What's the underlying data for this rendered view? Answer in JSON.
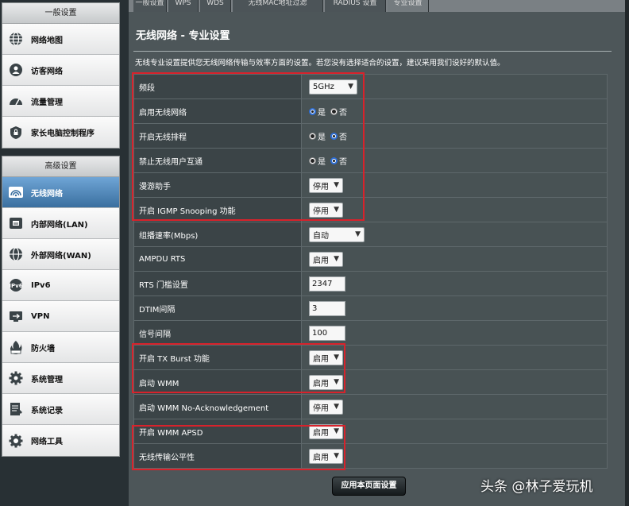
{
  "sidebar": {
    "general_title": "一般设置",
    "general_items": [
      {
        "label": "网络地图",
        "icon": "globe-icon"
      },
      {
        "label": "访客网络",
        "icon": "guest-network-icon"
      },
      {
        "label": "流量管理",
        "icon": "speedometer-icon"
      },
      {
        "label": "家长电脑控制程序",
        "icon": "parental-lock-icon"
      }
    ],
    "advanced_title": "高级设置",
    "advanced_items": [
      {
        "label": "无线网络",
        "icon": "wifi-icon",
        "active": true
      },
      {
        "label": "内部网络(LAN)",
        "icon": "lan-icon"
      },
      {
        "label": "外部网络(WAN)",
        "icon": "wan-globe-icon"
      },
      {
        "label": "IPv6",
        "icon": "ipv6-icon"
      },
      {
        "label": "VPN",
        "icon": "vpn-icon"
      },
      {
        "label": "防火墙",
        "icon": "firewall-icon"
      },
      {
        "label": "系统管理",
        "icon": "gear-icon"
      },
      {
        "label": "系统记录",
        "icon": "log-icon"
      },
      {
        "label": "网络工具",
        "icon": "tools-icon"
      }
    ]
  },
  "tabs": [
    {
      "label": "一般设置"
    },
    {
      "label": "WPS"
    },
    {
      "label": "WDS"
    },
    {
      "label": "无线MAC地址过滤"
    },
    {
      "label": "RADIUS 设置"
    },
    {
      "label": "专业设置",
      "active": true
    }
  ],
  "main": {
    "title": "无线网络 - 专业设置",
    "description": "无线专业设置提供您无线网络传输与效率方面的设置。若您没有选择适合的设置，建议采用我们设好的默认值。",
    "apply_label": "应用本页面设置"
  },
  "settings": [
    {
      "label": "频段",
      "type": "select",
      "value": "5GHz"
    },
    {
      "label": "启用无线网络",
      "type": "radio",
      "options": [
        "是",
        "否"
      ],
      "selected": 0
    },
    {
      "label": "开启无线排程",
      "type": "radio",
      "options": [
        "是",
        "否"
      ],
      "selected": 1
    },
    {
      "label": "禁止无线用户互通",
      "type": "radio",
      "options": [
        "是",
        "否"
      ],
      "selected": 1
    },
    {
      "label": "漫游助手",
      "type": "select",
      "value": "停用"
    },
    {
      "label": "开启 IGMP Snooping 功能",
      "type": "select",
      "value": "停用"
    },
    {
      "label": "组播速率(Mbps)",
      "type": "select",
      "value": "自动"
    },
    {
      "label": "AMPDU RTS",
      "type": "select",
      "value": "启用"
    },
    {
      "label": "RTS 门槛设置",
      "type": "input",
      "value": "2347"
    },
    {
      "label": "DTIM间隔",
      "type": "input",
      "value": "3"
    },
    {
      "label": "信号间隔",
      "type": "input",
      "value": "100"
    },
    {
      "label": "开启 TX Burst 功能",
      "type": "select",
      "value": "启用"
    },
    {
      "label": "启动 WMM",
      "type": "select",
      "value": "启用"
    },
    {
      "label": "启动 WMM No-Acknowledgement",
      "type": "select",
      "value": "停用"
    },
    {
      "label": "开启 WMM APSD",
      "type": "select",
      "value": "启用"
    },
    {
      "label": "无线传输公平性",
      "type": "select",
      "value": "启用"
    }
  ],
  "watermark": "头条 @林子爱玩机",
  "colors": {
    "highlight": "#d8222b",
    "active_menu": "#4a83b8",
    "panel": "#4d5659"
  }
}
